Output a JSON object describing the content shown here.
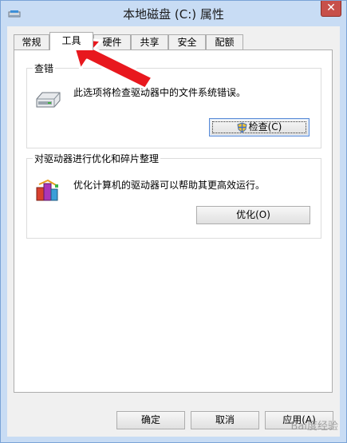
{
  "window": {
    "title": "本地磁盘 (C:) 属性",
    "close": "✕"
  },
  "tabs": [
    {
      "label": "常规"
    },
    {
      "label": "工具"
    },
    {
      "label": "硬件"
    },
    {
      "label": "共享"
    },
    {
      "label": "安全"
    },
    {
      "label": "配额"
    }
  ],
  "check_group": {
    "title": "查错",
    "description": "此选项将检查驱动器中的文件系统错误。",
    "button": "检查(C)"
  },
  "optimize_group": {
    "title": "对驱动器进行优化和碎片整理",
    "description": "优化计算机的驱动器可以帮助其更高效运行。",
    "button": "优化(O)"
  },
  "footer": {
    "ok": "确定",
    "cancel": "取消",
    "apply": "应用(A)"
  },
  "watermark": "Bai度经验",
  "colors": {
    "accent_arrow": "#e8181e",
    "titlebar": "#c8dcf4",
    "close_button": "#c7504a"
  },
  "icons": [
    "drive-icon",
    "shield-icon",
    "defrag-icon",
    "close-icon",
    "arrow-annotation"
  ]
}
